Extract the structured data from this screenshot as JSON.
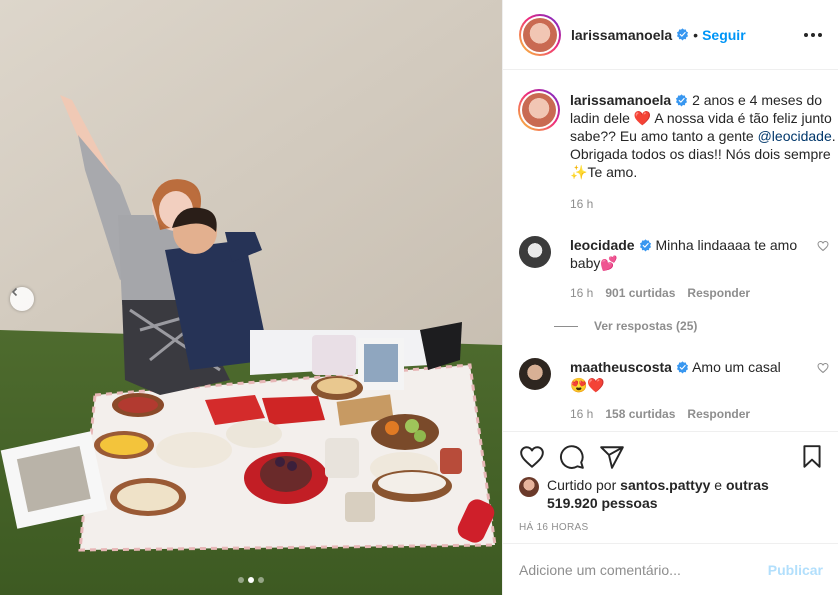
{
  "post": {
    "author": "larissamanoela",
    "follow_label": "Seguir",
    "separator": "•",
    "caption": {
      "username": "larissamanoela",
      "text_1": "2 anos e 4 meses do ladin dele",
      "emoji_heart": "❤️",
      "text_2": "A nossa vida é tão feliz junto sabe?? Eu amo tanto a gente",
      "mention": "@leocidade",
      "text_3": ". Obrigada todos os dias!! Nós dois sempre",
      "emoji_sparkles": "✨",
      "text_4": "Te amo.",
      "time": "16 h"
    },
    "carousel": {
      "total": 3,
      "active": 2
    }
  },
  "comments": [
    {
      "username": "leocidade",
      "text": "Minha lindaaaa te amo baby",
      "emoji": "💕",
      "time": "16 h",
      "likes": "901 curtidas",
      "reply_label": "Responder",
      "view_replies": "Ver respostas (25)"
    },
    {
      "username": "maatheuscosta",
      "text": "Amo um casal",
      "emoji": "😍❤️",
      "time": "16 h",
      "likes": "158 curtidas",
      "reply_label": "Responder"
    }
  ],
  "likes": {
    "prefix": "Curtido por",
    "user": "santos.pattyy",
    "middle": "e",
    "others": "outras 519.920 pessoas"
  },
  "post_time": "HÁ 16 HORAS",
  "comment_box": {
    "placeholder": "Adicione um comentário...",
    "publish_label": "Publicar"
  },
  "colors": {
    "link_blue": "#0095f6",
    "mention_blue": "#00376b",
    "verified_blue": "#3897f0",
    "secondary_text": "#8e8e8e",
    "publish_disabled": "#b2dffc"
  },
  "icons": [
    "chevron-left-icon",
    "more-icon",
    "verified-icon",
    "heart-icon",
    "comment-icon",
    "share-icon",
    "bookmark-icon"
  ]
}
